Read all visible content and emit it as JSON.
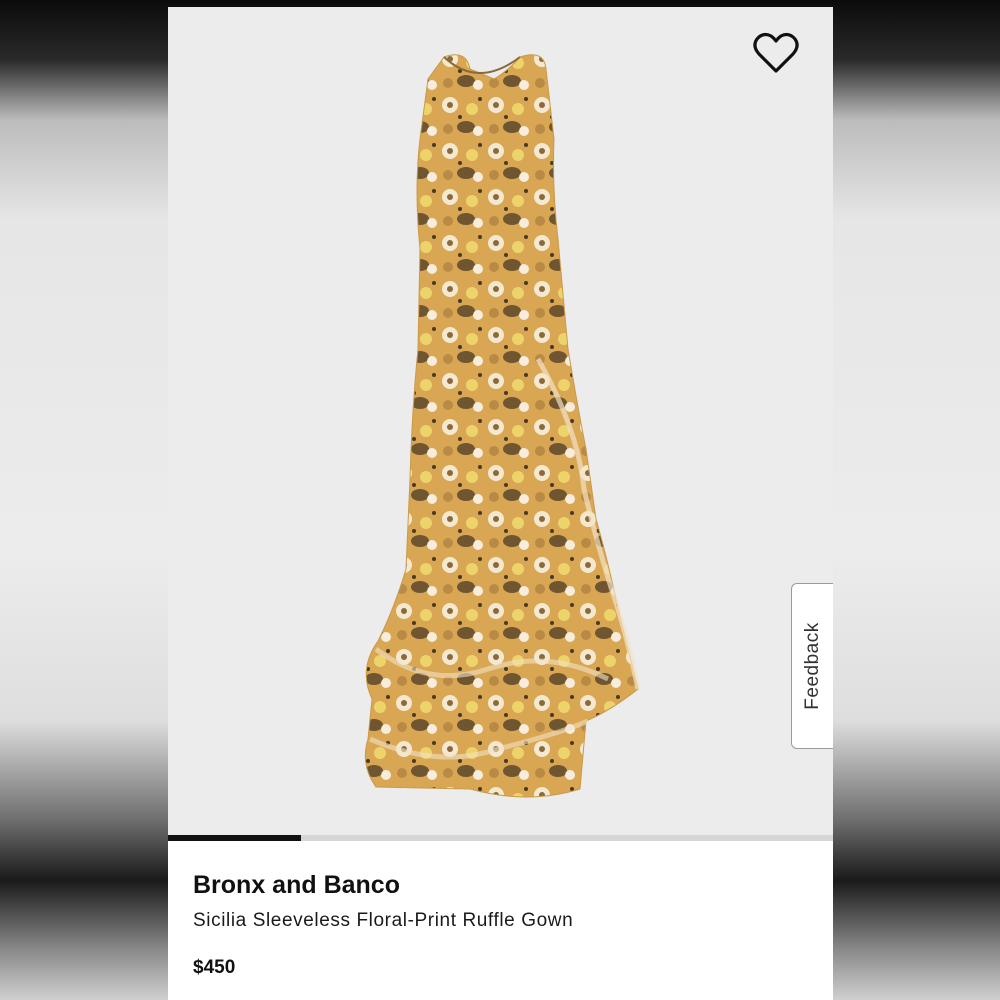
{
  "product": {
    "brand": "Bronx and Banco",
    "name": "Sicilia Sleeveless Floral-Print Ruffle Gown",
    "price": "$450",
    "image_alt": "Floral-print ruffle gown"
  },
  "gallery": {
    "progress_fraction": 0.2
  },
  "feedback": {
    "label": "Feedback"
  },
  "icons": {
    "favorite": "heart-outline-icon"
  },
  "colors": {
    "image_background": "#ececec",
    "progress_fill": "#111111",
    "progress_track": "#d6d6d6",
    "dress_base": "#d9a654",
    "text_primary": "#111111"
  }
}
